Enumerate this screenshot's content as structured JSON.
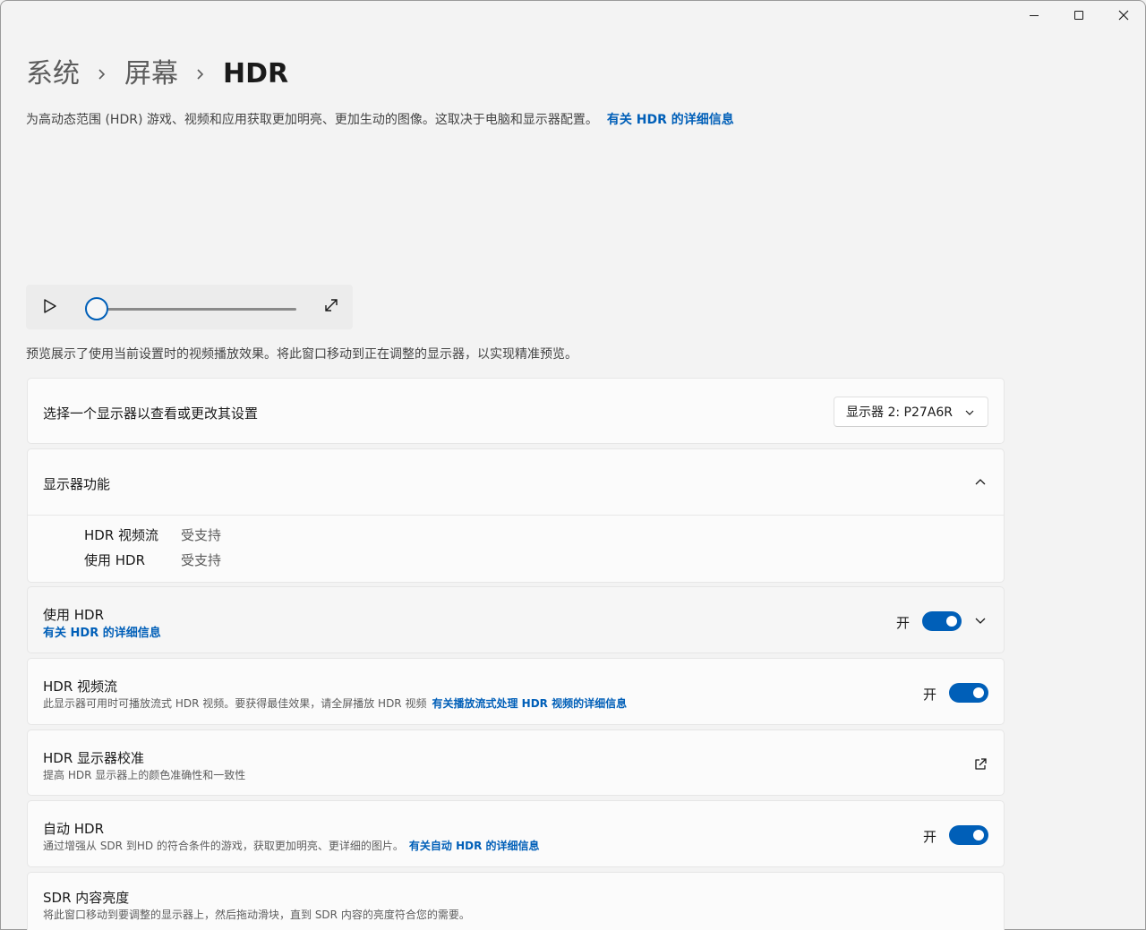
{
  "window": {
    "minimize_icon": "minimize-icon",
    "maximize_icon": "maximize-icon",
    "close_icon": "close-icon"
  },
  "breadcrumb": {
    "items": [
      "系统",
      "屏幕"
    ],
    "current": "HDR"
  },
  "description": {
    "text": "为高动态范围 (HDR) 游戏、视频和应用获取更加明亮、更加生动的图像。这取决于电脑和显示器配置。",
    "link": "有关 HDR 的详细信息"
  },
  "player": {
    "play_icon": "play-icon",
    "expand_icon": "expand-icon",
    "progress": 0
  },
  "preview_note": "预览展示了使用当前设置时的视频播放效果。将此窗口移动到正在调整的显示器，以实现精准预览。",
  "display_select": {
    "label": "选择一个显示器以查看或更改其设置",
    "selected": "显示器 2: P27A6R"
  },
  "capabilities": {
    "title": "显示器功能",
    "rows": [
      {
        "name": "HDR 视频流",
        "value": "受支持"
      },
      {
        "name": "使用 HDR",
        "value": "受支持"
      }
    ]
  },
  "use_hdr": {
    "title": "使用 HDR",
    "link": "有关 HDR 的详细信息",
    "state": "开"
  },
  "hdr_video": {
    "title": "HDR 视频流",
    "subtitle": "此显示器可用时可播放流式 HDR 视频。要获得最佳效果，请全屏播放 HDR 视频",
    "link": "有关播放流式处理 HDR 视频的详细信息",
    "state": "开"
  },
  "calibration": {
    "title": "HDR 显示器校准",
    "subtitle": "提高 HDR 显示器上的颜色准确性和一致性",
    "icon": "open-external-icon"
  },
  "auto_hdr": {
    "title": "自动 HDR",
    "subtitle": "通过增强从 SDR 到HD 的符合条件的游戏，获取更加明亮、更详细的图片。",
    "link": "有关自动 HDR 的详细信息",
    "state": "开"
  },
  "sdr_brightness": {
    "title": "SDR 内容亮度",
    "subtitle": "将此窗口移动到要调整的显示器上，然后拖动滑块，直到 SDR 内容的亮度符合您的需要。"
  },
  "colors": {
    "accent": "#005fb8",
    "background": "#f3f3f3",
    "card": "#fbfbfb"
  }
}
